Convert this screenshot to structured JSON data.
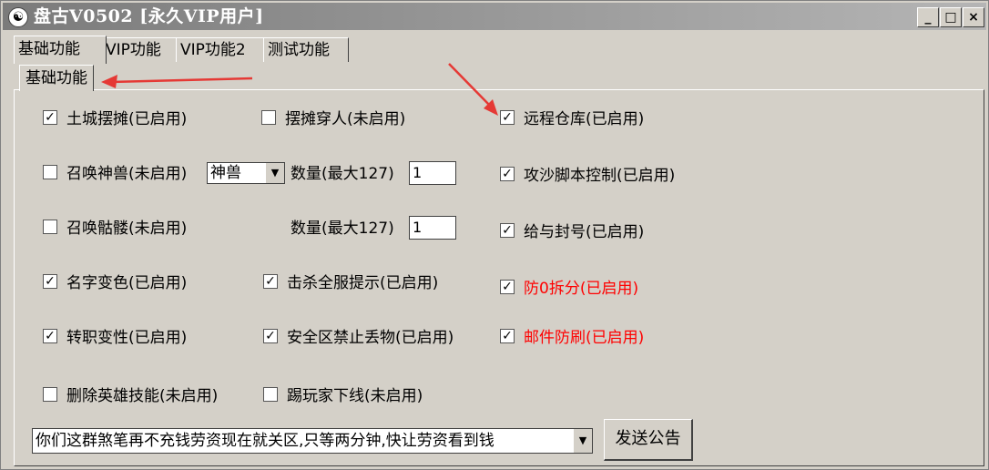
{
  "window": {
    "title": "盘古V0502 [永久VIP用户]",
    "icon": "app-logo-icon",
    "controls": {
      "minimize": "_",
      "maximize": "□",
      "close": "×"
    }
  },
  "tabs": [
    {
      "label": "基础功能",
      "active": true
    },
    {
      "label": "VIP功能",
      "active": false
    },
    {
      "label": "VIP功能2",
      "active": false
    },
    {
      "label": "测试功能",
      "active": false
    }
  ],
  "subtab": {
    "label": "基础功能"
  },
  "options": {
    "tucheng": {
      "label": "土城摆摊(已启用)",
      "checked": true
    },
    "baitan": {
      "label": "摆摊穿人(未启用)",
      "checked": false
    },
    "cangku": {
      "label": "远程仓库(已启用)",
      "checked": true
    },
    "shenshou": {
      "label": "召唤神兽(未启用)",
      "checked": false
    },
    "gongsha": {
      "label": "攻沙脚本控制(已启用)",
      "checked": true
    },
    "kulou": {
      "label": "召唤骷髅(未启用)",
      "checked": false
    },
    "fenghao": {
      "label": "给与封号(已启用)",
      "checked": true
    },
    "mingzi": {
      "label": "名字变色(已启用)",
      "checked": true
    },
    "jisha": {
      "label": "击杀全服提示(已启用)",
      "checked": true
    },
    "fang0": {
      "label": "防0拆分(已启用)",
      "checked": true,
      "color": "#ff0000"
    },
    "zhuanzhi": {
      "label": "转职变性(已启用)",
      "checked": true
    },
    "anquan": {
      "label": "安全区禁止丢物(已启用)",
      "checked": true
    },
    "youjian": {
      "label": "邮件防刷(已启用)",
      "checked": true,
      "color": "#ff0000"
    },
    "shanchu": {
      "label": "删除英雄技能(未启用)",
      "checked": false
    },
    "ti": {
      "label": "踢玩家下线(未启用)",
      "checked": false
    }
  },
  "shenshou_select": {
    "value": "神兽"
  },
  "count_label": "数量(最大127)",
  "shenshou_count": "1",
  "kulou_count": "1",
  "announcement": {
    "value": "你们这群煞笔再不充钱劳资现在就关区,只等两分钟,快让劳资看到钱"
  },
  "send_button": "发送公告",
  "colors": {
    "background": "#d4d0c8",
    "accent_red": "#ff0000"
  }
}
